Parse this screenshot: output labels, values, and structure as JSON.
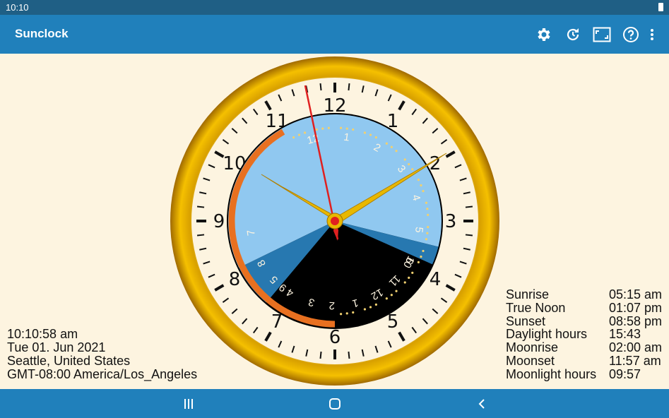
{
  "status_bar": {
    "time": "10:10"
  },
  "app_bar": {
    "title": "Sunclock",
    "icons": [
      "gear-icon",
      "refresh-icon",
      "fullscreen-icon",
      "help-icon",
      "more-vert-icon"
    ]
  },
  "clock": {
    "dial_numbers": [
      "12",
      "1",
      "2",
      "3",
      "4",
      "5",
      "6",
      "7",
      "8",
      "9",
      "10",
      "11"
    ],
    "inner_day_numbers": [
      "12",
      "1",
      "2",
      "3",
      "4",
      "5",
      "6",
      "7",
      "8",
      "9"
    ],
    "inner_night_numbers": [
      "10",
      "11",
      "12",
      "1",
      "2",
      "3",
      "4",
      "5"
    ]
  },
  "info_left": {
    "time": "10:10:58 am",
    "date": "Tue 01. Jun 2021",
    "location": "Seattle, United States",
    "timezone": "GMT-08:00 America/Los_Angeles"
  },
  "info_right": [
    {
      "label": "Sunrise",
      "value": "05:15 am"
    },
    {
      "label": "True Noon",
      "value": "01:07 pm"
    },
    {
      "label": "Sunset",
      "value": "08:58 pm"
    },
    {
      "label": "Daylight hours",
      "value": "15:43"
    },
    {
      "label": "Moonrise",
      "value": "02:00 am"
    },
    {
      "label": "Moonset",
      "value": "11:57 am"
    },
    {
      "label": "Moonlight hours",
      "value": "09:57"
    }
  ],
  "colors": {
    "app_bar": "#2080bb",
    "status_bar": "#1f5f85",
    "background": "#fdf4e0",
    "day_sky": "#90c8f0",
    "twilight": "#2778b0",
    "night": "#000000",
    "daylight_arc": "#e87020",
    "hands": "#f0c000",
    "second_hand": "#e02020"
  }
}
